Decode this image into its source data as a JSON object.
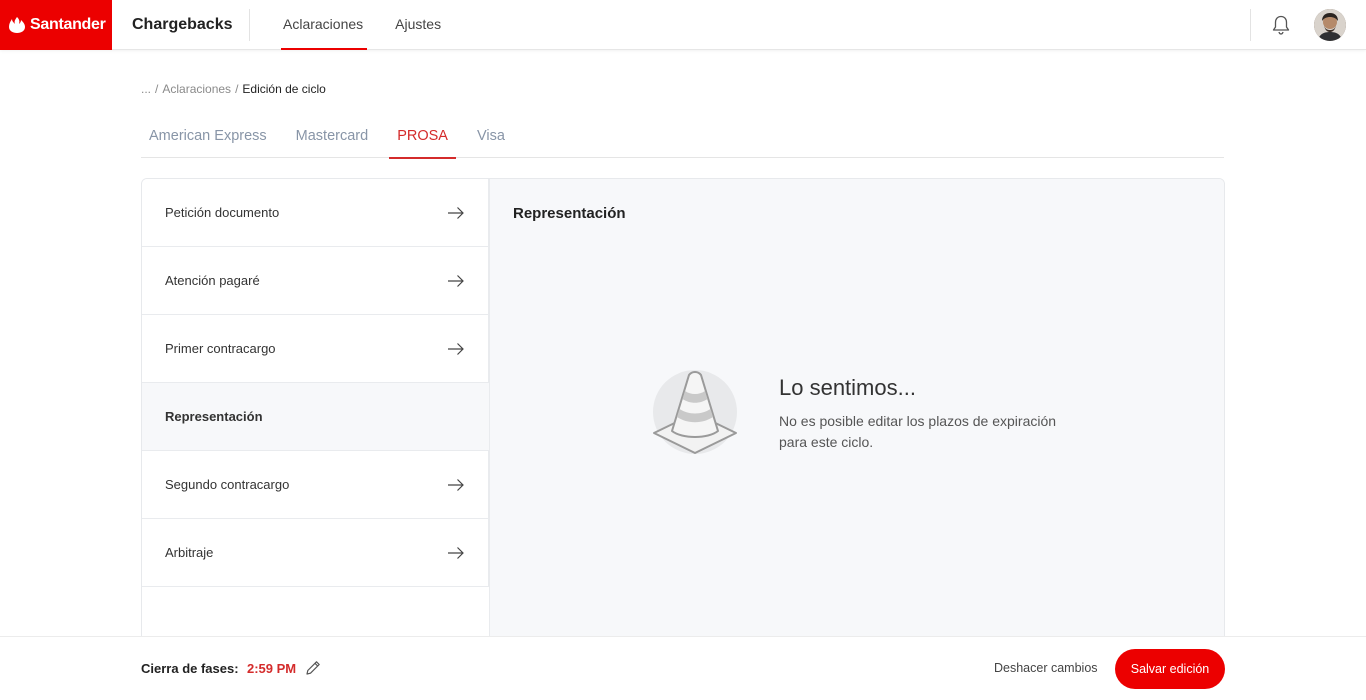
{
  "header": {
    "brand": "Santander",
    "app_title": "Chargebacks",
    "nav": [
      {
        "label": "Aclaraciones",
        "active": true
      },
      {
        "label": "Ajustes",
        "active": false
      }
    ],
    "icons": [
      "bell-icon",
      "avatar"
    ]
  },
  "breadcrumb": {
    "ellipsis": "...",
    "sep": "/",
    "parent": "Aclaraciones",
    "current": "Edición de ciclo"
  },
  "tabs": [
    {
      "label": "American Express",
      "active": false
    },
    {
      "label": "Mastercard",
      "active": false
    },
    {
      "label": "PROSA",
      "active": true
    },
    {
      "label": "Visa",
      "active": false
    }
  ],
  "sidebar": {
    "items": [
      {
        "label": "Petición documento",
        "active": false
      },
      {
        "label": "Atención pagaré",
        "active": false
      },
      {
        "label": "Primer contracargo",
        "active": false
      },
      {
        "label": "Representación",
        "active": true
      },
      {
        "label": "Segundo contracargo",
        "active": false
      },
      {
        "label": "Arbitraje",
        "active": false
      }
    ]
  },
  "content": {
    "title": "Representación",
    "empty_state": {
      "title": "Lo sentimos...",
      "description": "No es posible editar los plazos de expiración para este ciclo.",
      "icon": "traffic-cone-icon"
    }
  },
  "footer": {
    "phase_label": "Cierra de fases:",
    "phase_time": "2:59 PM",
    "undo_label": "Deshacer cambios",
    "save_label": "Salvar edición"
  },
  "colors": {
    "brand_red": "#ec0000",
    "accent_red": "#d42b2b",
    "tab_inactive": "#8895a7",
    "content_bg": "#f7f8fa"
  }
}
